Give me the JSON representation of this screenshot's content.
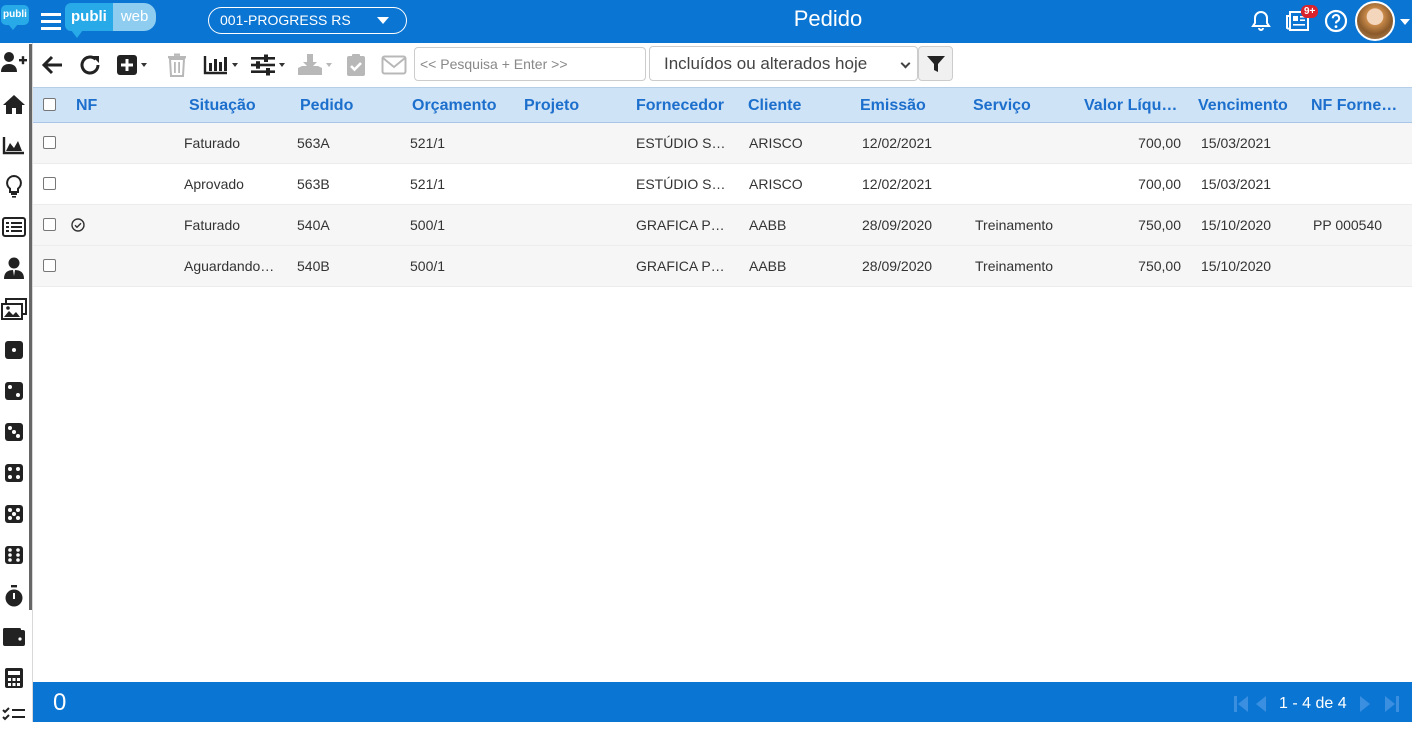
{
  "app": {
    "brand_left": "publi",
    "brand_right": "web",
    "mini_logo": "publi"
  },
  "header": {
    "company": "001-PROGRESS RS",
    "title": "Pedido",
    "news_badge": "9+"
  },
  "toolbar": {
    "search_placeholder": "<< Pesquisa + Enter >>",
    "period": "Incluídos ou alterados hoje"
  },
  "grid": {
    "columns": [
      "NF",
      "Situação",
      "Pedido",
      "Orçamento",
      "Projeto",
      "Fornecedor",
      "Cliente",
      "Emissão",
      "Serviço",
      "Valor Líqu…",
      "Vencimento",
      "NF Forne…"
    ],
    "rows": [
      {
        "nf_icon": "",
        "situacao": "Faturado",
        "pedido": "563A",
        "orcamento": "521/1",
        "projeto": "",
        "fornecedor": "ESTÚDIO S…",
        "cliente": "ARISCO",
        "emissao": "12/02/2021",
        "servico": "",
        "valor": "700,00",
        "vencimento": "15/03/2021",
        "nf_fornecedor": ""
      },
      {
        "nf_icon": "",
        "situacao": "Aprovado",
        "pedido": "563B",
        "orcamento": "521/1",
        "projeto": "",
        "fornecedor": "ESTÚDIO S…",
        "cliente": "ARISCO",
        "emissao": "12/02/2021",
        "servico": "",
        "valor": "700,00",
        "vencimento": "15/03/2021",
        "nf_fornecedor": ""
      },
      {
        "nf_icon": "check-circle-icon",
        "situacao": "Faturado",
        "pedido": "540A",
        "orcamento": "500/1",
        "projeto": "",
        "fornecedor": "GRAFICA P…",
        "cliente": "AABB",
        "emissao": "28/09/2020",
        "servico": "Treinamento",
        "valor": "750,00",
        "vencimento": "15/10/2020",
        "nf_fornecedor": "PP 000540"
      },
      {
        "nf_icon": "",
        "situacao": "Aguardando…",
        "pedido": "540B",
        "orcamento": "500/1",
        "projeto": "",
        "fornecedor": "GRAFICA P…",
        "cliente": "AABB",
        "emissao": "28/09/2020",
        "servico": "Treinamento",
        "valor": "750,00",
        "vencimento": "15/10/2020",
        "nf_fornecedor": ""
      }
    ]
  },
  "footer": {
    "selected_count": "0",
    "pager": "1 - 4 de 4"
  },
  "colors": {
    "primary": "#0a75d3",
    "header_bg": "#cfe3f7",
    "header_text": "#1c6fcc",
    "badge": "#d9232d"
  }
}
